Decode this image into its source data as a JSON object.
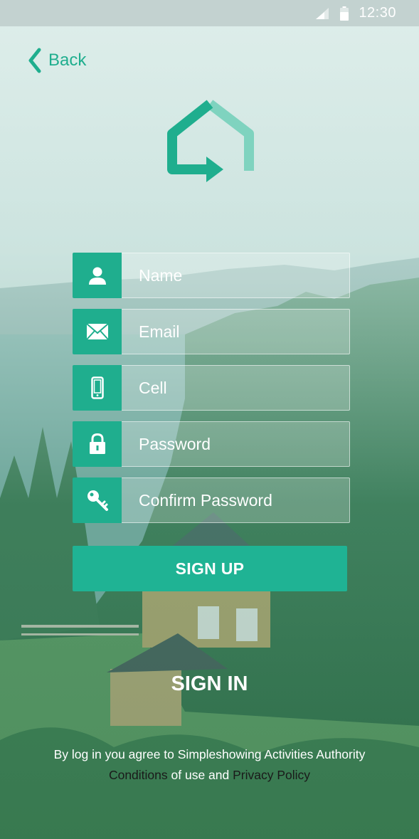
{
  "status_bar": {
    "time": "12:30"
  },
  "nav": {
    "back_label": "Back"
  },
  "form": {
    "fields": [
      {
        "icon": "user-icon",
        "placeholder": "Name"
      },
      {
        "icon": "envelope-icon",
        "placeholder": "Email"
      },
      {
        "icon": "phone-icon",
        "placeholder": "Cell"
      },
      {
        "icon": "lock-icon",
        "placeholder": "Password"
      },
      {
        "icon": "key-icon",
        "placeholder": "Confirm Password"
      }
    ],
    "submit_label": "SIGN UP"
  },
  "signin_label": "SIGN IN",
  "legal": {
    "line1": "By log in you agree to Simpleshowing Activities Authority",
    "conditions_link": "Conditions",
    "of_use_text": " of use and ",
    "privacy_link": "Privacy Policy"
  },
  "colors": {
    "accent": "#1fae8e",
    "button": "#1fb394"
  }
}
